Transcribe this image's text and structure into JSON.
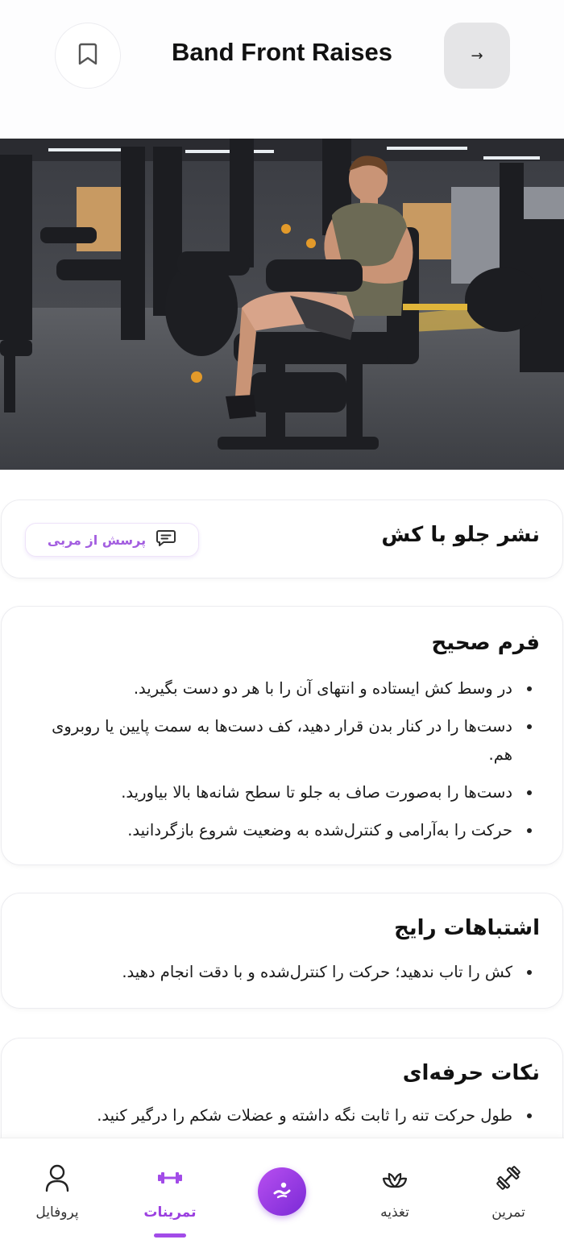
{
  "header": {
    "title": "Band Front Raises",
    "back_glyph": "→"
  },
  "exercise": {
    "fa_name": "نشر جلو با کش",
    "ask_coach_label": "پرسش از مربی"
  },
  "sections": {
    "form": {
      "title": "فرم صحیح",
      "items": [
        "در وسط کش ایستاده و انتهای آن را با هر دو دست بگیرید.",
        "دست‌ها را در کنار بدن قرار دهید، کف دست‌ها به سمت پایین یا روبروی هم.",
        "دست‌ها را به‌صورت صاف به جلو تا سطح شانه‌ها بالا بیاورید.",
        "حرکت را به‌آرامی و کنترل‌شده به وضعیت شروع بازگردانید."
      ]
    },
    "mistakes": {
      "title": "اشتباهات رایج",
      "items": [
        "کش را تاب ندهید؛ حرکت را کنترل‌شده و با دقت انجام دهید."
      ]
    },
    "tips": {
      "title": "نکات حرفه‌ای",
      "items": [
        "طول حرکت تنه را ثابت نگه داشته و عضلات شکم را درگیر کنید."
      ]
    }
  },
  "nav": {
    "profile": "پروفایل",
    "workouts": "تمرینات",
    "nutrition": "تغذیه",
    "exercise": "تمرین",
    "active": "workouts"
  },
  "colors": {
    "accent": "#9b3fe0",
    "accent_dark": "#7a2ad6",
    "ask_text": "#a35ee0"
  },
  "icons": {
    "bookmark": "bookmark-icon",
    "back": "arrow-right-icon",
    "chat": "chat-icon",
    "profile": "user-icon",
    "workouts": "dumbbell-icon",
    "coach": "coach-logo-icon",
    "nutrition": "leaf-icon",
    "exercise": "barbell-icon"
  }
}
